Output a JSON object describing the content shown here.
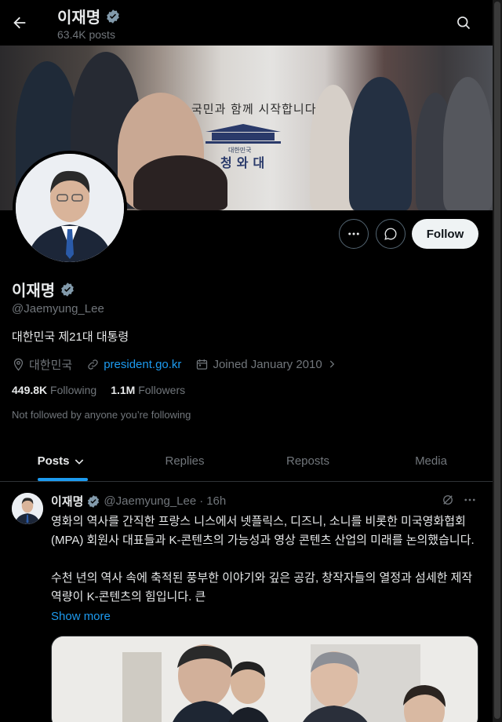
{
  "header": {
    "name": "이재명",
    "posts_count": "63.4K posts"
  },
  "banner": {
    "slogan": "국민과 함께 시작합니다",
    "emblem_small": "대한민국",
    "emblem_large": "청와대"
  },
  "actions": {
    "follow_label": "Follow"
  },
  "profile": {
    "name": "이재명",
    "handle": "@Jaemyung_Lee",
    "bio": "대한민국 제21대 대통령",
    "location": "대한민국",
    "website": "president.go.kr",
    "joined": "Joined January 2010",
    "following_count": "449.8K",
    "following_label": "Following",
    "followers_count": "1.1M",
    "followers_label": "Followers",
    "not_followed": "Not followed by anyone you’re following"
  },
  "tabs": [
    {
      "label": "Posts"
    },
    {
      "label": "Replies"
    },
    {
      "label": "Reposts"
    },
    {
      "label": "Media"
    }
  ],
  "post": {
    "name": "이재명",
    "handle": "@Jaemyung_Lee",
    "separator": "·",
    "time": "16h",
    "paragraph1": "영화의 역사를 간직한 프랑스 니스에서 넷플릭스, 디즈니, 소니를 비롯한 미국영화협회(MPA) 회원사 대표들과 K-콘텐츠의 가능성과 영상 콘텐츠 산업의 미래를 논의했습니다.",
    "paragraph2": "수천 년의 역사 속에 축적된 풍부한 이야기와 깊은 공감, 창작자들의 열정과 섬세한 제작 역량이 K-콘텐츠의 힘입니다. 큰",
    "show_more": "Show more"
  },
  "colors": {
    "accent": "#1d9bf0",
    "background": "#000000",
    "text": "#e7e9ea",
    "muted": "#71767b",
    "verified": "#829aab"
  }
}
